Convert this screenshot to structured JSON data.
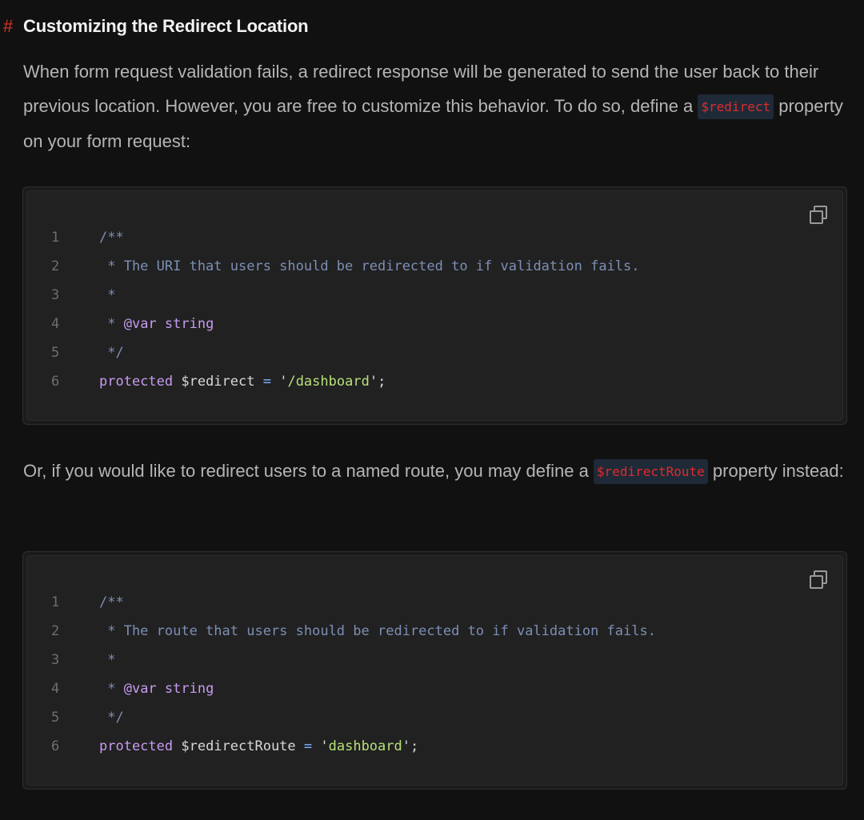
{
  "heading": {
    "hash": "#",
    "title": "Customizing the Redirect Location"
  },
  "para1": {
    "text_before": "When form request validation fails, a redirect response will be generated to send the user back to their previous location. However, you are free to customize this behavior. To do so, define a ",
    "code": "$redirect",
    "text_after": " property on your form request:"
  },
  "code_block_1": {
    "copy_icon": "copy-icon",
    "lines": [
      {
        "num": "1",
        "tokens": [
          {
            "t": "comment",
            "v": "/**"
          }
        ]
      },
      {
        "num": "2",
        "tokens": [
          {
            "t": "comment",
            "v": " * The URI that users should be redirected to if validation fails."
          }
        ]
      },
      {
        "num": "3",
        "tokens": [
          {
            "t": "comment",
            "v": " *"
          }
        ]
      },
      {
        "num": "4",
        "tokens": [
          {
            "t": "comment",
            "v": " * "
          },
          {
            "t": "tag",
            "v": "@var string"
          }
        ]
      },
      {
        "num": "5",
        "tokens": [
          {
            "t": "comment",
            "v": " */"
          }
        ]
      },
      {
        "num": "6",
        "tokens": [
          {
            "t": "keyword",
            "v": "protected"
          },
          {
            "t": "var",
            "v": " $redirect "
          },
          {
            "t": "op",
            "v": "="
          },
          {
            "t": "quote",
            "v": " '"
          },
          {
            "t": "string",
            "v": "/dashboard"
          },
          {
            "t": "quote",
            "v": "'"
          },
          {
            "t": "punct",
            "v": ";"
          }
        ]
      }
    ]
  },
  "para2": {
    "text_before": "Or, if you would like to redirect users to a named route, you may define a ",
    "code": "$redirectRoute",
    "text_after": " property instead:"
  },
  "code_block_2": {
    "copy_icon": "copy-icon",
    "lines": [
      {
        "num": "1",
        "tokens": [
          {
            "t": "comment",
            "v": "/**"
          }
        ]
      },
      {
        "num": "2",
        "tokens": [
          {
            "t": "comment",
            "v": " * The route that users should be redirected to if validation fails."
          }
        ]
      },
      {
        "num": "3",
        "tokens": [
          {
            "t": "comment",
            "v": " *"
          }
        ]
      },
      {
        "num": "4",
        "tokens": [
          {
            "t": "comment",
            "v": " * "
          },
          {
            "t": "tag",
            "v": "@var string"
          }
        ]
      },
      {
        "num": "5",
        "tokens": [
          {
            "t": "comment",
            "v": " */"
          }
        ]
      },
      {
        "num": "6",
        "tokens": [
          {
            "t": "keyword",
            "v": "protected"
          },
          {
            "t": "var",
            "v": " $redirectRoute "
          },
          {
            "t": "op",
            "v": "="
          },
          {
            "t": "quote",
            "v": " '"
          },
          {
            "t": "string",
            "v": "dashboard"
          },
          {
            "t": "quote",
            "v": "'"
          },
          {
            "t": "punct",
            "v": ";"
          }
        ]
      }
    ]
  },
  "colors": {
    "background": "#111111",
    "heading_hash": "#d9342b",
    "inline_code_text": "#e02a2a",
    "inline_code_bg": "#1f2a38",
    "comment": "#7c8fb5",
    "keyword": "#c79bf0",
    "string": "#b7e07a",
    "operator": "#7fb5ff"
  }
}
